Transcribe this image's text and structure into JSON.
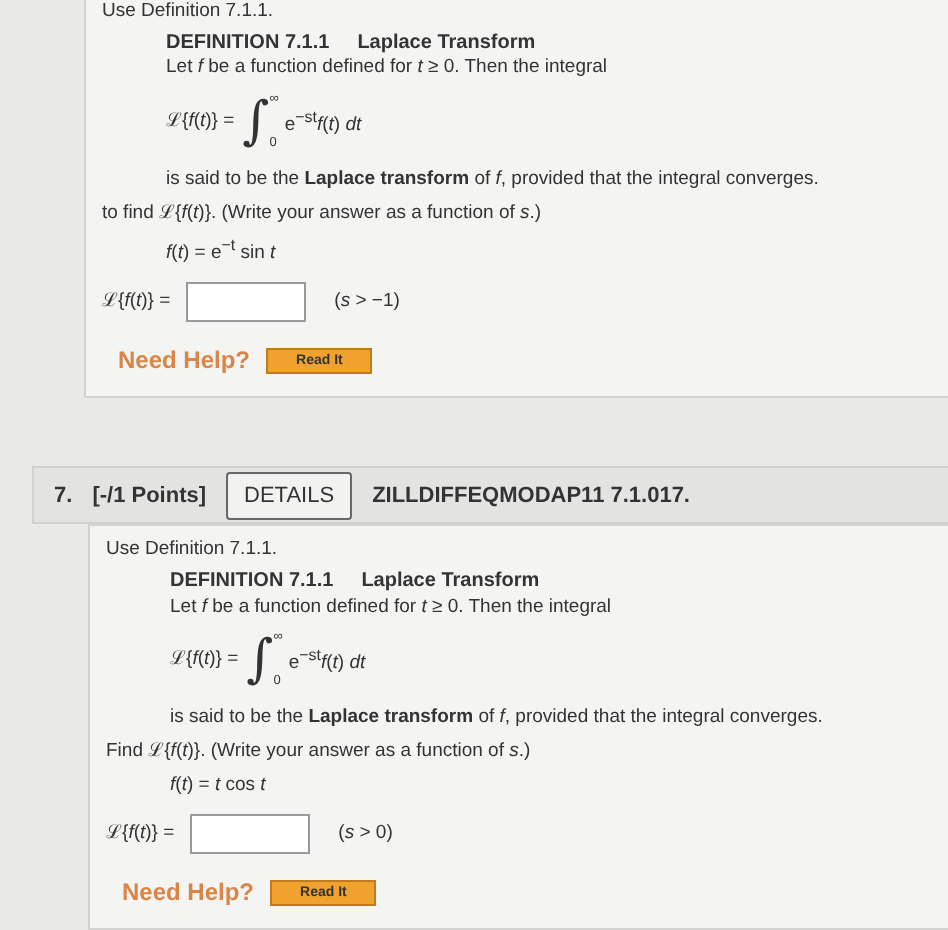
{
  "problems": [
    {
      "intro": "Use Definition 7.1.1.",
      "definition": {
        "label": "DEFINITION 7.1.1",
        "name": "Laplace Transform",
        "lead": "Let *f* be a function defined for *t* ≥ 0. Then the integral",
        "formula": {
          "lhs": "ℒ{*f*(*t*)} =",
          "sign": "∫",
          "upper": "∞",
          "lower": "0",
          "integrand": "e$^{−st}$*f*(*t*) *dt*"
        },
        "tail": "is said to be the **Laplace transform** of *f*, provided that the integral converges."
      },
      "task": "to find ℒ{*f*(*t*)}. (Write your answer as a function of *s*.)",
      "function": "*f*(*t*) = e$^{−t}$ sin *t*",
      "answer": {
        "lhs": "ℒ{*f*(*t*)} =",
        "condition": "(*s* > −1)"
      },
      "help": {
        "label": "Need Help?",
        "button": "Read It"
      }
    },
    {
      "header": {
        "number": "7.",
        "points": "[-/1 Points]",
        "details": "DETAILS",
        "code": "ZILLDIFFEQMODAP11 7.1.017."
      },
      "intro": "Use Definition 7.1.1.",
      "definition": {
        "label": "DEFINITION 7.1.1",
        "name": "Laplace Transform",
        "lead": "Let *f* be a function defined for *t* ≥ 0. Then the integral",
        "formula": {
          "lhs": "ℒ{*f*(*t*)} =",
          "sign": "∫",
          "upper": "∞",
          "lower": "0",
          "integrand": "e$^{−st}$*f*(*t*) *dt*"
        },
        "tail": "is said to be the **Laplace transform** of *f*, provided that the integral converges."
      },
      "task": "Find ℒ{*f*(*t*)}. (Write your answer as a function of *s*.)",
      "function": "*f*(*t*) = *t* cos *t*",
      "answer": {
        "lhs": "ℒ{*f*(*t*)} =",
        "condition": "(*s* > 0)"
      },
      "help": {
        "label": "Need Help?",
        "button": "Read It"
      }
    }
  ]
}
